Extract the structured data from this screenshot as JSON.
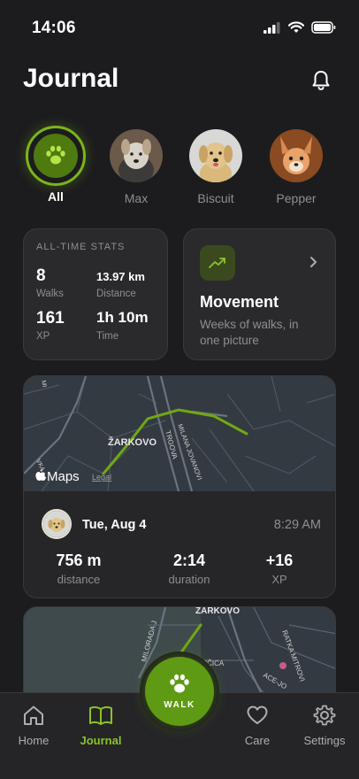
{
  "status": {
    "time": "14:06"
  },
  "header": {
    "title": "Journal"
  },
  "pets": [
    {
      "name": "All"
    },
    {
      "name": "Max"
    },
    {
      "name": "Biscuit"
    },
    {
      "name": "Pepper"
    }
  ],
  "stats": {
    "title": "ALL-TIME STATS",
    "walks_value": "8",
    "walks_label": "Walks",
    "distance_value": "13.97 km",
    "distance_label": "Distance",
    "xp_value": "161",
    "xp_label": "XP",
    "time_value": "1h 10m",
    "time_label": "Time"
  },
  "movement": {
    "title": "Movement",
    "subtitle": "Weeks of walks, in one picture"
  },
  "walk": {
    "date": "Tue, Aug 4",
    "time": "8:29 AM",
    "distance_value": "756 m",
    "distance_label": "distance",
    "duration_value": "2:14",
    "duration_label": "duration",
    "xp_value": "+16",
    "xp_label": "XP",
    "map_brand": "Maps",
    "map_legal": "Legal",
    "map_labels": [
      "ŽARKOVO",
      "MILANA JOVANOVI",
      "TRGOVA",
      "VKA",
      "MI"
    ]
  },
  "map2": {
    "labels": [
      "ŽARKOVO",
      "MILORADA J",
      "RATKA MITROVI",
      "JE ĐURIČICA",
      "ACE-JO"
    ]
  },
  "tabs": [
    {
      "label": "Home"
    },
    {
      "label": "Journal"
    },
    {
      "label": "WALK"
    },
    {
      "label": "Care"
    },
    {
      "label": "Settings"
    }
  ],
  "colors": {
    "accent": "#7cb518",
    "background": "#1c1c1e",
    "card": "#2a2a2c"
  }
}
